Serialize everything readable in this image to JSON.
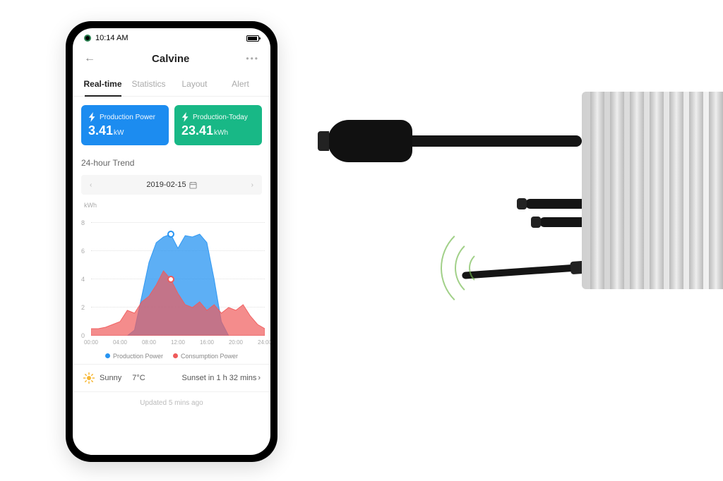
{
  "status": {
    "time": "10:14 AM"
  },
  "header": {
    "title": "Calvine"
  },
  "tabs": [
    "Real-time",
    "Statistics",
    "Layout",
    "Alert"
  ],
  "active_tab": 0,
  "cards": {
    "production_power": {
      "label": "Production Power",
      "value": "3.41",
      "unit": "kW"
    },
    "production_today": {
      "label": "Production-Today",
      "value": "23.41",
      "unit": "kWh"
    }
  },
  "trend": {
    "title": "24-hour Trend",
    "date": "2019-02-15",
    "ylabel": "kWh"
  },
  "legend": {
    "prod": "Production Power",
    "cons": "Consumption Power"
  },
  "weather": {
    "conditions": "Sunny",
    "temp": "7°C",
    "sunset": "Sunset in 1 h 32 mins"
  },
  "footer": "Updated 5 mins ago",
  "chart_data": {
    "type": "area",
    "categories": [
      "00:00",
      "04:00",
      "08:00",
      "12:00",
      "16:00",
      "20:00",
      "24:00"
    ],
    "ylabel": "kWh",
    "ylim": [
      0,
      8
    ],
    "yticks": [
      0,
      2,
      4,
      6,
      8
    ],
    "series": [
      {
        "name": "Production Power",
        "color": "#2794f2",
        "values24": [
          0,
          0,
          0,
          0,
          0,
          0,
          0.4,
          2.8,
          5.2,
          6.6,
          7.0,
          7.2,
          6.2,
          7.1,
          7.0,
          7.2,
          6.6,
          4.0,
          1.0,
          0,
          0,
          0,
          0,
          0,
          0
        ]
      },
      {
        "name": "Consumption Power",
        "color": "#ef5b5b",
        "values24": [
          0.5,
          0.5,
          0.6,
          0.8,
          1.0,
          1.8,
          1.6,
          2.4,
          2.8,
          3.6,
          4.6,
          4.0,
          3.0,
          2.2,
          2.0,
          2.4,
          1.8,
          2.2,
          1.6,
          2.0,
          1.8,
          2.2,
          1.4,
          0.8,
          0.5
        ]
      }
    ],
    "markers": [
      {
        "series": 0,
        "hour": 11,
        "value": 7.2
      },
      {
        "series": 1,
        "hour": 11,
        "value": 4.0
      }
    ],
    "xticks": [
      "00:00",
      "04:00",
      "08:00",
      "12:00",
      "16:00",
      "20:00",
      "24:00"
    ]
  }
}
